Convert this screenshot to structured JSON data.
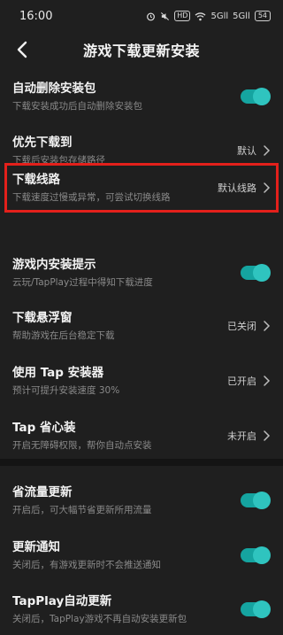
{
  "status_bar": {
    "time": "16:00",
    "icons": [
      "alarm-icon",
      "mute-icon",
      "hd-icon",
      "wifi-icon",
      "signal-icon",
      "signal-icon",
      "battery-icon"
    ],
    "hd_label": "HD",
    "signal_label_1": "5Gll",
    "signal_label_2": "5Gll",
    "battery_level": "54"
  },
  "header": {
    "title": "游戏下载更新安装"
  },
  "settings": [
    {
      "title": "自动删除安装包",
      "subtitle": "下载安装成功后自动删除安装包",
      "control": "toggle",
      "on": true
    },
    {
      "title": "优先下载到",
      "subtitle": "下载后安装包存储路径",
      "control": "value",
      "value": "默认"
    },
    {
      "title": "下载线路",
      "subtitle": "下载速度过慢或异常，可尝试切换线路",
      "control": "value",
      "value": "默认线路"
    },
    {
      "title": "游戏内安装提示",
      "subtitle": "云玩/TapPlay过程中得知下载进度",
      "control": "toggle",
      "on": true
    },
    {
      "title": "下载悬浮窗",
      "subtitle": "帮助游戏在后台稳定下载",
      "control": "value",
      "value": "已关闭"
    },
    {
      "title": "使用 Tap 安装器",
      "subtitle": "预计可提升安装速度 30%",
      "control": "value",
      "value": "已开启"
    },
    {
      "title": "Tap 省心装",
      "subtitle": "开启无障碍权限，帮你自动点安装",
      "control": "value",
      "value": "未开启"
    },
    {
      "title": "省流量更新",
      "subtitle": "开启后，可大幅节省更新所用流量",
      "control": "toggle",
      "on": true
    },
    {
      "title": "更新通知",
      "subtitle": "关闭后，有游戏更新时不会推送通知",
      "control": "toggle",
      "on": true
    },
    {
      "title": "TapPlay自动更新",
      "subtitle": "关闭后，TapPlay游戏不再自动安装更新包",
      "control": "toggle",
      "on": true
    }
  ],
  "colors": {
    "background": "#1f1f1f",
    "toggle_on": "#2fc4bf",
    "highlight": "#e3201b"
  }
}
